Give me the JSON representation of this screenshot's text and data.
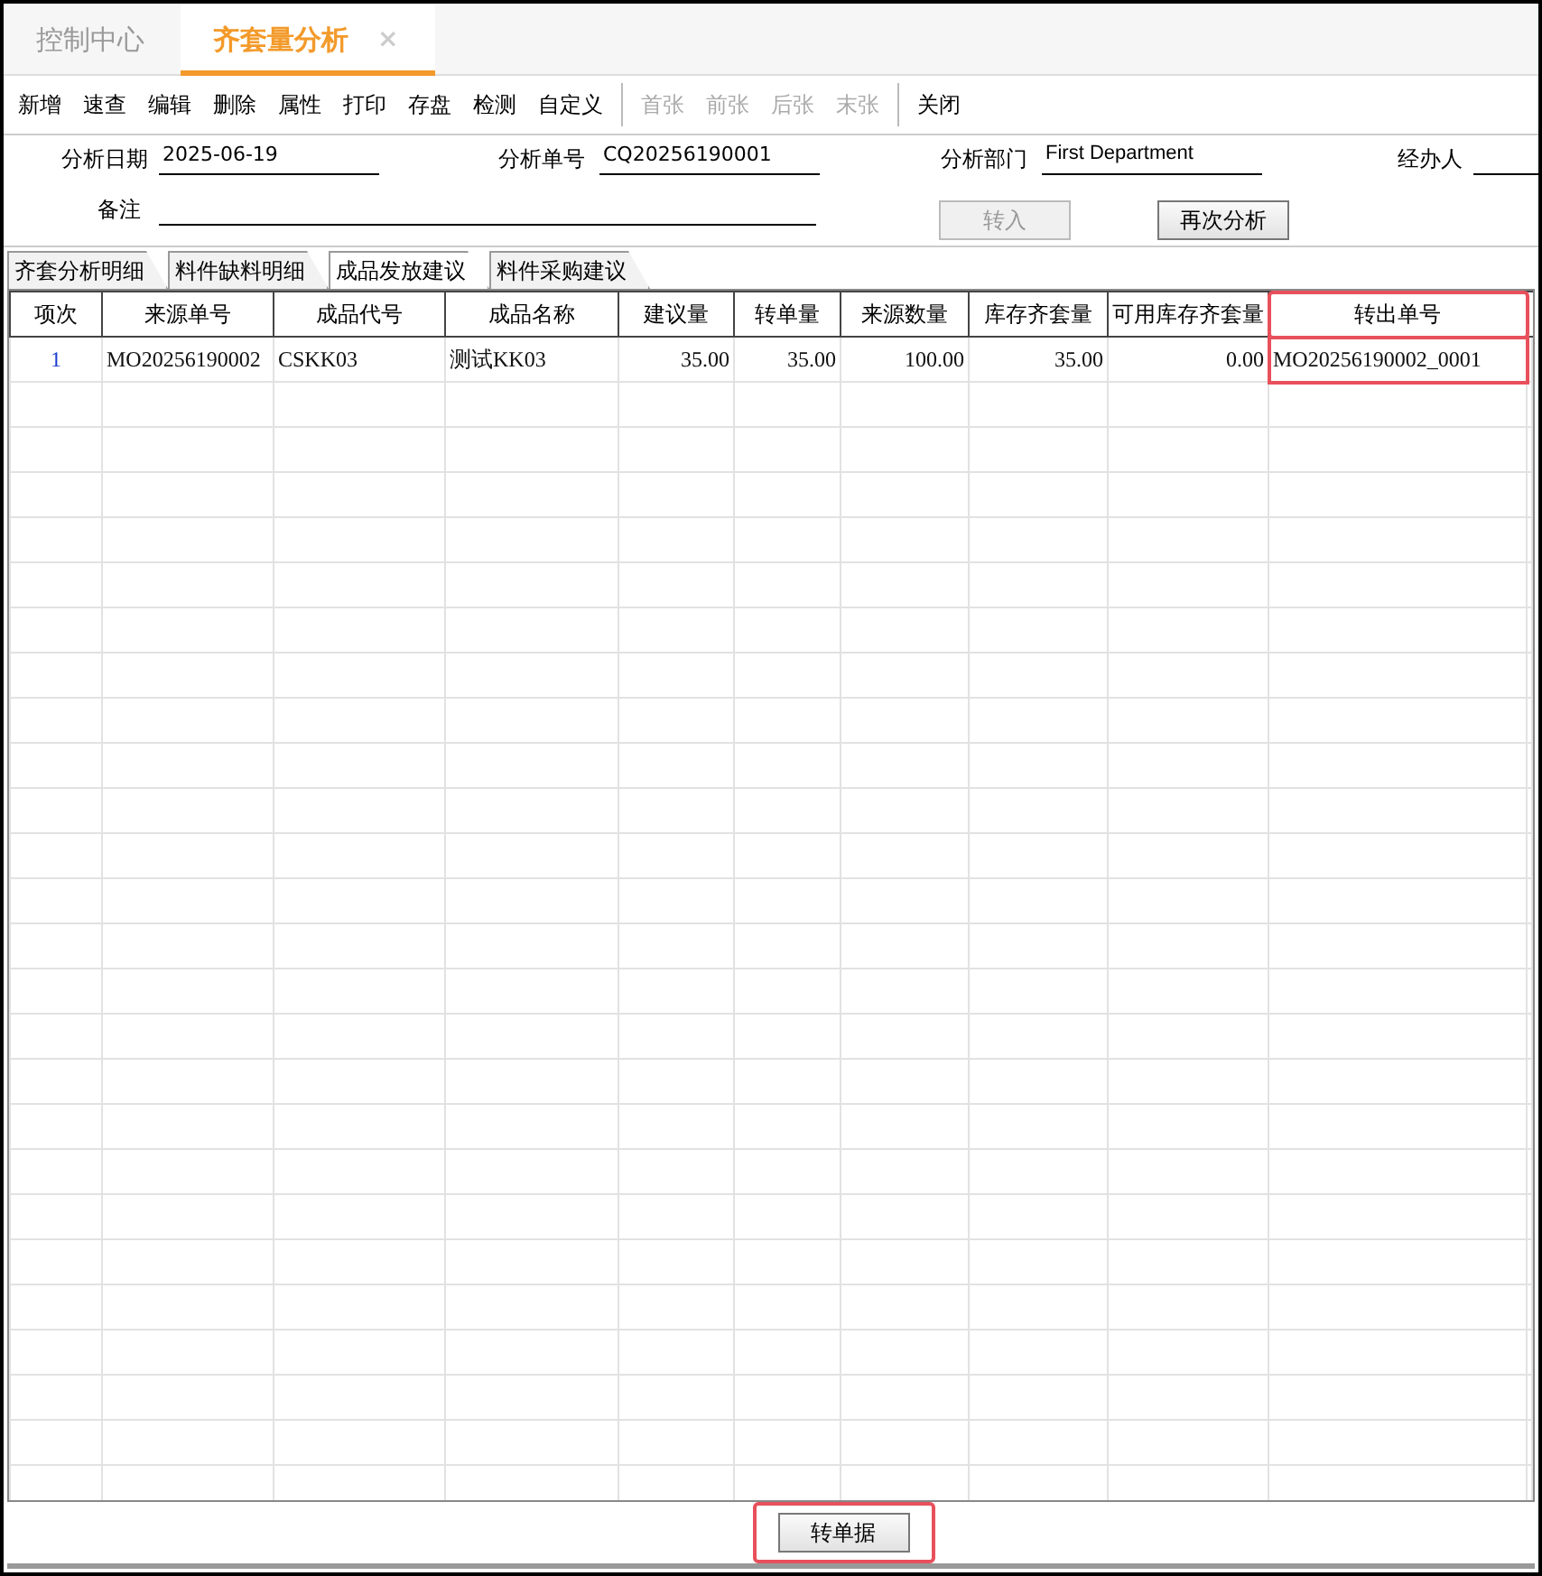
{
  "top_tabs": [
    {
      "label": "控制中心",
      "selected": false,
      "closable": false
    },
    {
      "label": "齐套量分析",
      "selected": true,
      "closable": true,
      "close": "×"
    }
  ],
  "toolbar": [
    {
      "label": "新增",
      "disabled": false
    },
    {
      "label": "速查",
      "disabled": false
    },
    {
      "label": "编辑",
      "disabled": false
    },
    {
      "label": "删除",
      "disabled": false
    },
    {
      "label": "属性",
      "disabled": false
    },
    {
      "label": "打印",
      "disabled": false
    },
    {
      "label": "存盘",
      "disabled": false
    },
    {
      "label": "检测",
      "disabled": false
    },
    {
      "label": "自定义",
      "disabled": false,
      "separator_after": true
    },
    {
      "label": "首张",
      "disabled": true
    },
    {
      "label": "前张",
      "disabled": true
    },
    {
      "label": "后张",
      "disabled": true
    },
    {
      "label": "末张",
      "disabled": true,
      "separator_after": true
    },
    {
      "label": "关闭",
      "disabled": false
    }
  ],
  "form": {
    "date": {
      "label": "分析日期",
      "value": "2025-06-19"
    },
    "number": {
      "label": "分析单号",
      "value": "CQ20256190001"
    },
    "department": {
      "label": "分析部门",
      "value": "First Department"
    },
    "handler": {
      "label": "经办人"
    },
    "remark": {
      "label": "备注"
    },
    "buttons": [
      {
        "label": "转入",
        "disabled": true
      },
      {
        "label": "再次分析",
        "disabled": false
      }
    ]
  },
  "sub_tabs": [
    {
      "label": "齐套分析明细",
      "selected": false
    },
    {
      "label": "料件缺料明细",
      "selected": false
    },
    {
      "label": "成品发放建议",
      "selected": true
    },
    {
      "label": "料件采购建议",
      "selected": false
    }
  ],
  "table": {
    "columns": [
      {
        "label": "项次",
        "highlighted": false
      },
      {
        "label": "来源单号",
        "highlighted": false
      },
      {
        "label": "成品代号",
        "highlighted": false
      },
      {
        "label": "成品名称",
        "highlighted": false
      },
      {
        "label": "建议量",
        "highlighted": false
      },
      {
        "label": "转单量",
        "highlighted": false
      },
      {
        "label": "来源数量",
        "highlighted": false
      },
      {
        "label": "库存齐套量",
        "highlighted": false
      },
      {
        "label": "可用库存齐套量",
        "highlighted": false
      },
      {
        "label": "转出单号",
        "highlighted": true
      }
    ],
    "rows": [
      [
        "1",
        "MO20256190002",
        "CSKK03",
        "测试KK03",
        "35.00",
        "35.00",
        "100.00",
        "35.00",
        "0.00",
        "MO20256190002_0001"
      ]
    ]
  },
  "footer_button": {
    "label": "转单据",
    "highlighted": true
  }
}
